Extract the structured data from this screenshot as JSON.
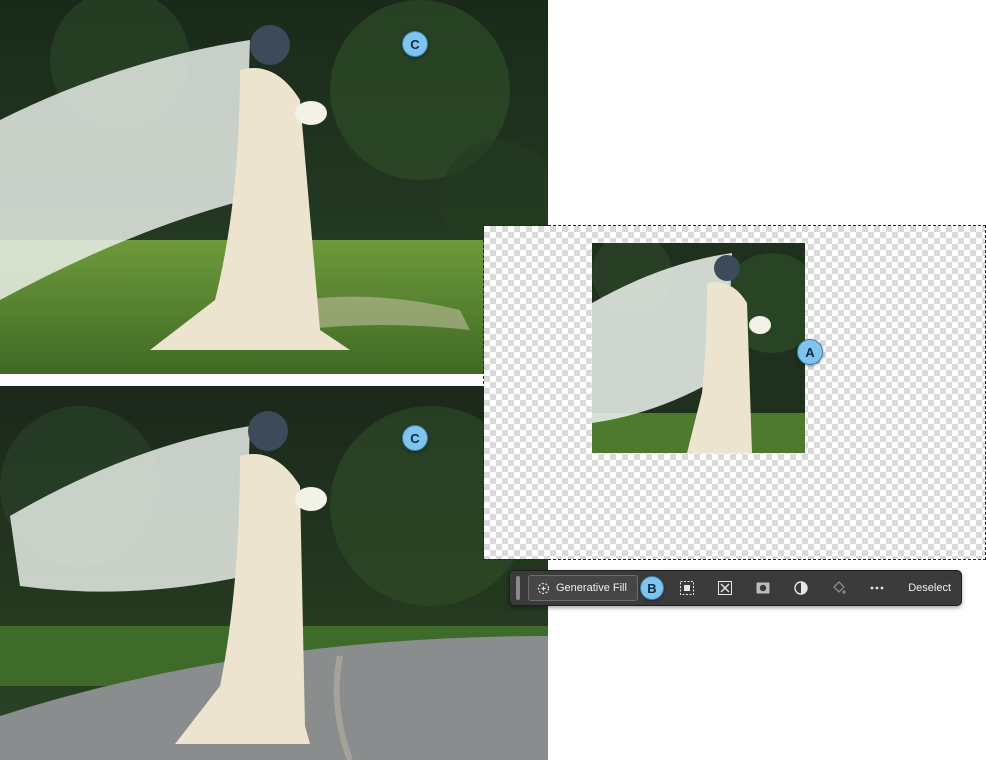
{
  "callouts": {
    "a": "A",
    "b": "B",
    "c_top": "C",
    "c_bottom": "C"
  },
  "taskbar": {
    "generative_fill_label": "Generative Fill",
    "tools": [
      "select-subject-icon",
      "invert-selection-icon",
      "create-mask-icon",
      "adjustment-icon",
      "fill-selection-icon",
      "more-options-icon"
    ],
    "deselect_label": "Deselect"
  },
  "colors": {
    "callout_fill": "#7fc3ee",
    "taskbar_bg": "#3b3b3b"
  }
}
